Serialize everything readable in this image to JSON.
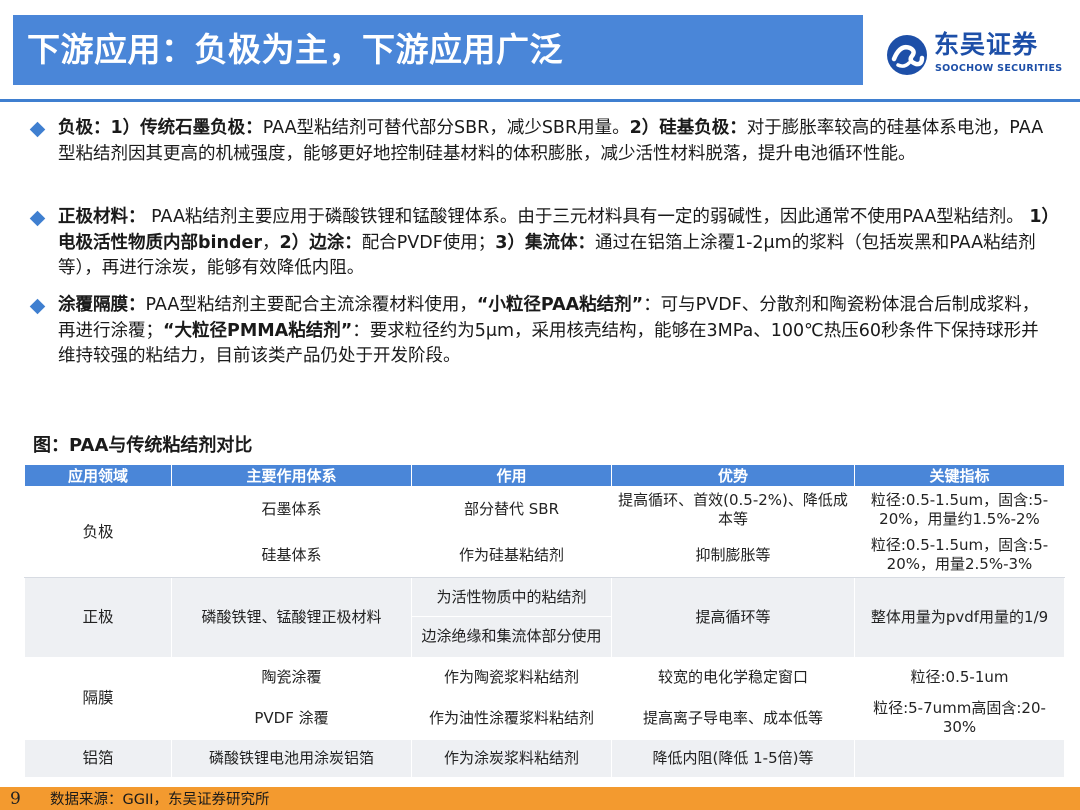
{
  "header": {
    "title": "下游应用：负极为主，下游应用广泛",
    "logo_cn": "东吴证券",
    "logo_en": "SOOCHOW SECURITIES"
  },
  "bullets": [
    [
      {
        "t": "负极：1）传统石墨负极：",
        "b": true
      },
      {
        "t": "PAA型粘结剂可替代部分SBR，减少SBR用量。",
        "b": false
      },
      {
        "t": "2）硅基负极：",
        "b": true
      },
      {
        "t": "对于膨胀率较高的硅基体系电池，PAA型粘结剂因其更高的机械强度，能够更好地控制硅基材料的体积膨胀，减少活性材料脱落，提升电池循环性能。",
        "b": false
      }
    ],
    [
      {
        "t": "正极材料：",
        "b": true
      },
      {
        "t": " PAA粘结剂主要应用于磷酸铁锂和锰酸锂体系。由于三元材料具有一定的弱碱性，因此通常不使用PAA型粘结剂。 ",
        "b": false
      },
      {
        "t": "1）电极活性物质内部binder",
        "b": true
      },
      {
        "t": "，",
        "b": false
      },
      {
        "t": "2）边涂：",
        "b": true
      },
      {
        "t": "配合PVDF使用；",
        "b": false
      },
      {
        "t": "3）集流体：",
        "b": true
      },
      {
        "t": "通过在铝箔上涂覆1-2μm的浆料（包括炭黑和PAA粘结剂等），再进行涂炭，能够有效降低内阻。",
        "b": false
      }
    ],
    [
      {
        "t": "涂覆隔膜：",
        "b": true
      },
      {
        "t": "PAA型粘结剂主要配合主流涂覆材料使用，",
        "b": false
      },
      {
        "t": "“小粒径PAA粘结剂”",
        "b": true
      },
      {
        "t": "：可与PVDF、分散剂和陶瓷粉体混合后制成浆料，再进行涂覆；",
        "b": false
      },
      {
        "t": "“大粒径PMMA粘结剂”",
        "b": true
      },
      {
        "t": "：要求粒径约为5μm，采用核壳结构，能够在3MPa、100℃热压60秒条件下保持球形并维持较强的粘结力，目前该类产品仍处于开发阶段。",
        "b": false
      }
    ]
  ],
  "figure": {
    "caption": "图：PAA与传统粘结剂对比"
  },
  "table": {
    "headers": [
      "应用领域",
      "主要作用体系",
      "作用",
      "优势",
      "关键指标"
    ],
    "groups": [
      {
        "category": "负极",
        "rows": [
          {
            "system": "石墨体系",
            "role": "部分替代 SBR",
            "advantage": "提高循环、首效(0.5-2%)、降低成本等",
            "metric": "粒径:0.5-1.5um，固含:5-20%，用量约1.5%-2%"
          },
          {
            "system": "硅基体系",
            "role": "作为硅基粘结剂",
            "advantage": "抑制膨胀等",
            "metric": "粒径:0.5-1.5um，固含:5-20%，用量2.5%-3%"
          }
        ]
      },
      {
        "category": "正极",
        "system": "磷酸铁锂、锰酸锂正极材料",
        "roles": [
          "为活性物质中的粘结剂",
          "边涂绝缘和集流体部分使用"
        ],
        "advantage": "提高循环等",
        "metric": "整体用量为pvdf用量的1/9"
      },
      {
        "category": "隔膜",
        "rows": [
          {
            "system": "陶瓷涂覆",
            "role": "作为陶瓷浆料粘结剂",
            "advantage": "较宽的电化学稳定窗口",
            "metric": "粒径:0.5-1um"
          },
          {
            "system": "PVDF 涂覆",
            "role": "作为油性涂覆浆料粘结剂",
            "advantage": "提高离子导电率、成本低等",
            "metric": "粒径:5-7umm高固含:20-30%"
          }
        ]
      },
      {
        "category": "铝箔",
        "system": "磷酸铁锂电池用涂炭铝箔",
        "role": "作为涂炭浆料粘结剂",
        "advantage": "降低内阻(降低 1-5倍)等",
        "metric": ""
      }
    ]
  },
  "footer": {
    "page": "9",
    "source": "数据来源：GGII，东吴证券研究所"
  },
  "colors": {
    "header_blue": "#4a86d8",
    "brand_blue": "#1d4fa8",
    "footer_orange": "#f39a2f",
    "row_shade": "#eef0f3"
  }
}
